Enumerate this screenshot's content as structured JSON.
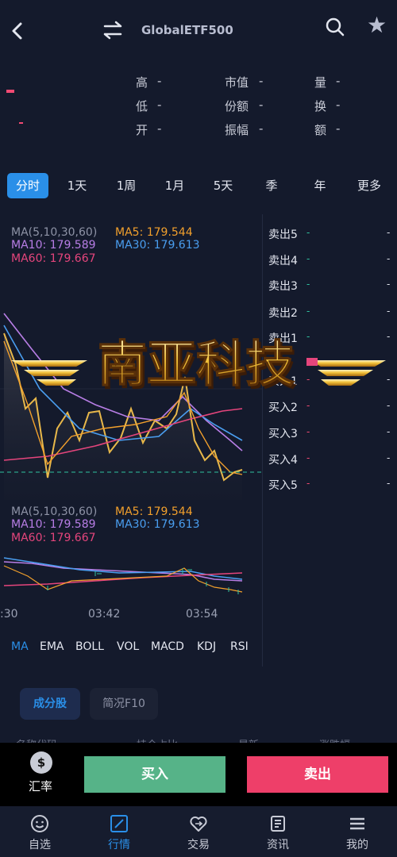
{
  "header": {
    "title": "GlobalETF500"
  },
  "stats": {
    "rows": [
      [
        {
          "label": "高",
          "value": "-"
        },
        {
          "label": "市值",
          "value": "-"
        },
        {
          "label": "量",
          "value": "-"
        }
      ],
      [
        {
          "label": "低",
          "value": "-"
        },
        {
          "label": "份额",
          "value": "-"
        },
        {
          "label": "换",
          "value": "-"
        }
      ],
      [
        {
          "label": "开",
          "value": "-"
        },
        {
          "label": "振幅",
          "value": "-"
        },
        {
          "label": "额",
          "value": "-"
        }
      ]
    ]
  },
  "period_tabs": [
    "分时",
    "1天",
    "1周",
    "1月",
    "5天",
    "季",
    "年",
    "更多"
  ],
  "main_legend": {
    "params": "MA(5,10,30,60)",
    "ma5": "MA5: 179.544",
    "ma10": "MA10: 179.589",
    "ma30": "MA30: 179.613",
    "ma60": "MA60: 179.667"
  },
  "sub_legend": {
    "params": "MA(5,10,30,60)",
    "ma5": "MA5: 179.544",
    "ma10": "MA10: 179.589",
    "ma30": "MA30: 179.613",
    "ma60": "MA60: 179.667"
  },
  "time_axis": [
    ":30",
    "03:42",
    "03:54"
  ],
  "order_book": {
    "asks": [
      {
        "label": "卖出5",
        "price": "-",
        "volume": "-"
      },
      {
        "label": "卖出4",
        "price": "-",
        "volume": "-"
      },
      {
        "label": "卖出3",
        "price": "-",
        "volume": "-"
      },
      {
        "label": "卖出2",
        "price": "-",
        "volume": "-"
      },
      {
        "label": "卖出1",
        "price": "-",
        "volume": "-"
      }
    ],
    "bids": [
      {
        "label": "买入1",
        "price": "-",
        "volume": "-"
      },
      {
        "label": "买入2",
        "price": "-",
        "volume": "-"
      },
      {
        "label": "买入3",
        "price": "-",
        "volume": "-"
      },
      {
        "label": "买入4",
        "price": "-",
        "volume": "-"
      },
      {
        "label": "买入5",
        "price": "-",
        "volume": "-"
      }
    ]
  },
  "indicator_tabs": [
    "MA",
    "EMA",
    "BOLL",
    "VOL",
    "MACD",
    "KDJ",
    "RSI"
  ],
  "section_tabs": [
    "成分股",
    "简况F10"
  ],
  "columns": [
    "名称代码",
    "持仓占比",
    "最新",
    "涨跌幅"
  ],
  "actions": {
    "fx_icon": "$",
    "fx_label": "汇率",
    "buy": "买入",
    "sell": "卖出"
  },
  "nav": [
    {
      "label": "自选",
      "icon": "smile-icon"
    },
    {
      "label": "行情",
      "icon": "chart-icon"
    },
    {
      "label": "交易",
      "icon": "heart-exchange-icon"
    },
    {
      "label": "资讯",
      "icon": "news-icon"
    },
    {
      "label": "我的",
      "icon": "menu-icon"
    }
  ],
  "logo_text": "南亚科技",
  "colors": {
    "background": "#141a2c",
    "accent": "#2a8fe8",
    "buy": "#56b388",
    "sell": "#ee3f69",
    "ma5": "#f2a02c",
    "ma10": "#b87ee6",
    "ma30": "#4a9ef0",
    "ma60": "#e5457c"
  }
}
